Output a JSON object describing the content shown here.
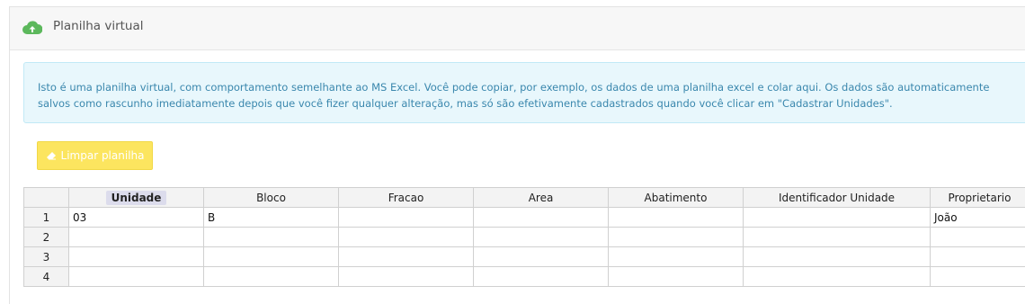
{
  "panel": {
    "title": "Planilha virtual",
    "icon": "cloud-upload-icon",
    "icon_color": "#5cb85c"
  },
  "alert": {
    "text": "Isto é uma planilha virtual, com comportamento semelhante ao MS Excel. Você pode copiar, por exemplo, os dados de uma planilha excel e colar aqui. Os dados são automaticamente salvos como rascunho imediatamente depois que você fizer qualquer alteração, mas só são efetivamente cadastrados quando você clicar em \"Cadastrar Unidades\"."
  },
  "toolbar": {
    "clear_label": "Limpar planilha",
    "clear_icon": "eraser-icon"
  },
  "sheet": {
    "columns": [
      "Unidade",
      "Bloco",
      "Fracao",
      "Area",
      "Abatimento",
      "Identificador Unidade",
      "Proprietario"
    ],
    "rows": [
      {
        "num": "1",
        "cells": [
          "03",
          "B",
          "",
          "",
          "",
          "",
          "João"
        ]
      },
      {
        "num": "2",
        "cells": [
          "",
          "",
          "",
          "",
          "",
          "",
          ""
        ]
      },
      {
        "num": "3",
        "cells": [
          "",
          "",
          "",
          "",
          "",
          "",
          ""
        ]
      },
      {
        "num": "4",
        "cells": [
          "",
          "",
          "",
          "",
          "",
          "",
          ""
        ]
      }
    ]
  }
}
